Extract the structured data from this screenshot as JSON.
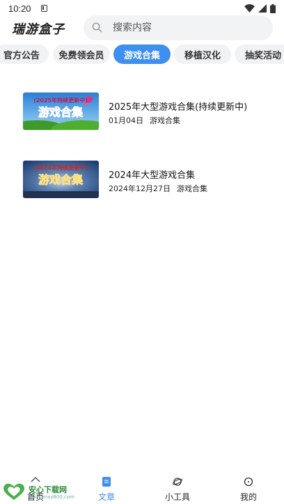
{
  "status_bar": {
    "time": "10:20"
  },
  "header": {
    "app_title": "瑞游盒子",
    "search_placeholder": "搜索内容"
  },
  "tabs": [
    {
      "label": "官方公告",
      "active": false
    },
    {
      "label": "免费领会员",
      "active": false
    },
    {
      "label": "游戏合集",
      "active": true
    },
    {
      "label": "移植汉化",
      "active": false
    },
    {
      "label": "抽奖活动",
      "active": false
    }
  ],
  "articles": [
    {
      "title": "2025年大型游戏合集(持续更新中)",
      "date": "01月04日",
      "category": "游戏合集",
      "thumb_caption": "(2025年持续更新中)",
      "thumb_main": "游戏合集"
    },
    {
      "title": "2024年大型游戏合集",
      "date": "2024年12月27日",
      "category": "游戏合集",
      "thumb_caption": "(2024年持续更新中)",
      "thumb_main": "游戏合集"
    }
  ],
  "bottom_nav": [
    {
      "label": "首页",
      "icon": "home-icon",
      "active": false
    },
    {
      "label": "文章",
      "icon": "article-icon",
      "active": true
    },
    {
      "label": "小工具",
      "icon": "tools-icon",
      "active": false
    },
    {
      "label": "我的",
      "icon": "profile-icon",
      "active": false
    }
  ],
  "watermark": {
    "name": "安心下载网",
    "url": "www.anxz800.com"
  },
  "colors": {
    "accent": "#3d8ff0",
    "tab_bg": "#f1f2f4",
    "search_bg": "#f2f3f5"
  }
}
